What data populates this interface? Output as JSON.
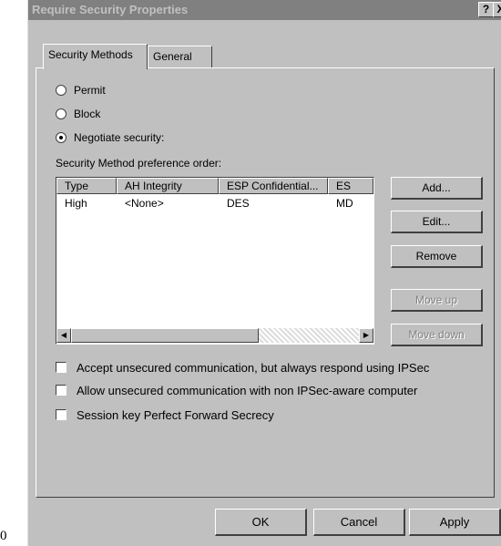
{
  "stray_glyph": "0",
  "window": {
    "title": "Require Security Properties",
    "help_glyph": "?",
    "close_glyph": "X"
  },
  "tabs": [
    {
      "label": "Security Methods",
      "active": true
    },
    {
      "label": "General",
      "active": false
    }
  ],
  "options": {
    "permit_label": "Permit",
    "block_label": "Block",
    "negotiate_label": "Negotiate security:",
    "selected": "Negotiate security:"
  },
  "list": {
    "caption": "Security Method preference order:",
    "columns": [
      "Type",
      "AH Integrity",
      "ESP Confidential...",
      "ES"
    ],
    "rows": [
      [
        "High",
        "<None>",
        "DES",
        "MD"
      ]
    ]
  },
  "side_buttons": {
    "add": "Add...",
    "edit": "Edit...",
    "remove": "Remove",
    "move_up": "Move up",
    "move_down": "Move down"
  },
  "checkboxes": {
    "accept_unsecured": "Accept unsecured communication, but always respond using IPSec",
    "allow_unsecured": "Allow unsecured communication with non IPSec-aware computer",
    "pfs": "Session key Perfect Forward Secrecy"
  },
  "footer": {
    "ok": "OK",
    "cancel": "Cancel",
    "apply": "Apply"
  },
  "colors": {
    "face": "#c0c0c0",
    "titlebar_inactive": "#808080",
    "disabled_text": "#808080"
  }
}
